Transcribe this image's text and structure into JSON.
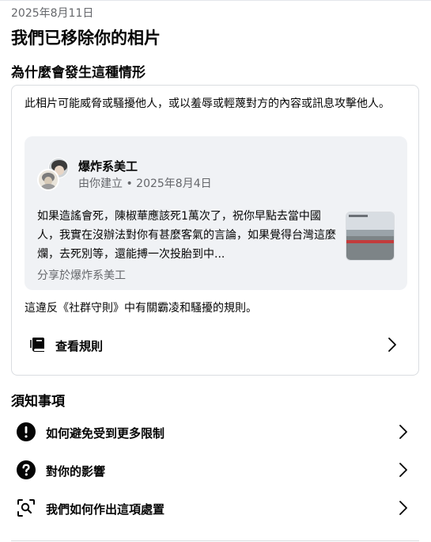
{
  "header": {
    "date": "2025年8月11日",
    "title": "我們已移除你的相片",
    "why_heading": "為什麼會發生這種情形"
  },
  "card": {
    "description": "此相片可能威脅或騷擾他人，或以羞辱或輕蔑對方的內容或訊息攻擊他人。",
    "post": {
      "author": "爆炸系美工",
      "meta": "由你建立 • 2025年8月4日",
      "text": "如果造謠會死，陳椒華應該死1萬次了，祝你早點去當中國人，我實在沒辦法對你有甚麼客氣的言論，如果覺得台灣這麼爛，去死別等，還能搏一次投胎到中...",
      "shared_to": "分享於爆炸系美工"
    },
    "violation_text": "這違反《社群守則》中有關霸凌和騷擾的規則。",
    "rules_link": {
      "label": "查看規則",
      "icon": "book-icon"
    }
  },
  "notices": {
    "heading": "須知事項",
    "items": [
      {
        "label": "如何避免受到更多限制",
        "icon": "exclamation-icon"
      },
      {
        "label": "對你的影響",
        "icon": "question-icon"
      },
      {
        "label": "我們如何作出這項處置",
        "icon": "search-review-icon"
      }
    ]
  },
  "colors": {
    "text_primary": "#050505",
    "text_secondary": "#65676b",
    "post_background": "#f0f2f5",
    "border": "#dadde1"
  }
}
